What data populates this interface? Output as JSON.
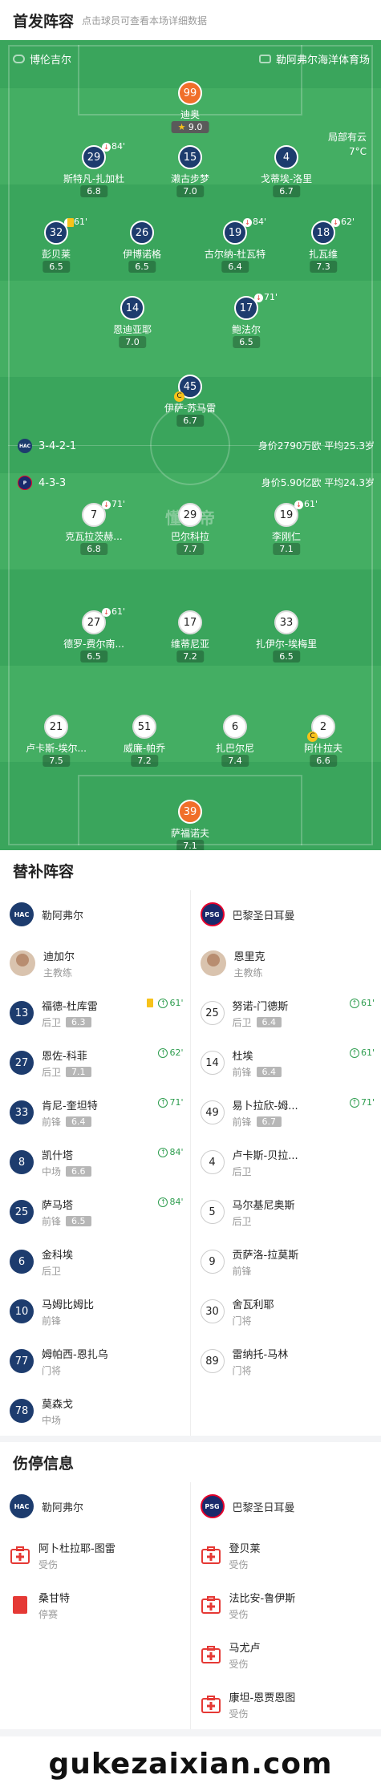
{
  "lineup_header": {
    "title": "首发阵容",
    "subtitle": "点击球员可查看本场详细数据"
  },
  "match": {
    "home_team": "博伦吉尔",
    "venue": "勒阿弗尔海洋体育场",
    "weather": "局部有云",
    "temperature": "7°C",
    "watermark": "懂球帝",
    "home_formation": "3-4-2-1",
    "home_value": "身价2790万欧 平均25.3岁",
    "away_formation": "4-3-3",
    "away_value": "身价5.90亿欧 平均24.3岁"
  },
  "home_players": [
    {
      "num": "99",
      "name": "迪奥",
      "rating": "9.0",
      "best": true
    },
    {
      "num": "29",
      "name": "斯特凡-扎加杜",
      "rating": "6.8",
      "sub": "84'"
    },
    {
      "num": "15",
      "name": "濑古步梦",
      "rating": "7.0"
    },
    {
      "num": "4",
      "name": "戈蒂埃-洛里",
      "rating": "6.7"
    },
    {
      "num": "32",
      "name": "彭贝莱",
      "rating": "6.5",
      "sub": "61'",
      "yellow": true
    },
    {
      "num": "26",
      "name": "伊博诺格",
      "rating": "6.5"
    },
    {
      "num": "19",
      "name": "古尔纳-杜瓦特",
      "rating": "6.4",
      "sub": "84'"
    },
    {
      "num": "18",
      "name": "扎瓦维",
      "rating": "7.3",
      "sub": "62'"
    },
    {
      "num": "14",
      "name": "恩迪亚耶",
      "rating": "7.0"
    },
    {
      "num": "17",
      "name": "鲍法尔",
      "rating": "6.5",
      "sub": "71'"
    },
    {
      "num": "45",
      "name": "伊萨-苏马雷",
      "rating": "6.7",
      "captain": "C"
    }
  ],
  "away_players": [
    {
      "num": "7",
      "name": "克瓦拉茨赫...",
      "rating": "6.8",
      "sub": "71'"
    },
    {
      "num": "29",
      "name": "巴尔科拉",
      "rating": "7.7"
    },
    {
      "num": "19",
      "name": "李刚仁",
      "rating": "7.1",
      "sub": "61'"
    },
    {
      "num": "27",
      "name": "德罗-费尔南...",
      "rating": "6.5",
      "sub": "61'"
    },
    {
      "num": "17",
      "name": "维蒂尼亚",
      "rating": "7.2"
    },
    {
      "num": "33",
      "name": "扎伊尔-埃梅里",
      "rating": "6.5"
    },
    {
      "num": "21",
      "name": "卢卡斯-埃尔...",
      "rating": "7.5"
    },
    {
      "num": "51",
      "name": "威廉-帕乔",
      "rating": "7.2"
    },
    {
      "num": "6",
      "name": "扎巴尔尼",
      "rating": "7.4"
    },
    {
      "num": "2",
      "name": "阿什拉夫",
      "rating": "6.6",
      "captain": "C"
    },
    {
      "num": "39",
      "name": "萨福诺夫",
      "rating": "7.1"
    }
  ],
  "subs": {
    "title": "替补阵容",
    "home_team": "勒阿弗尔",
    "away_team": "巴黎圣日耳曼",
    "home_coach": {
      "name": "迪加尔",
      "role": "主教练"
    },
    "away_coach": {
      "name": "恩里克",
      "role": "主教练"
    },
    "home": [
      {
        "num": "13",
        "name": "福德-杜库雷",
        "pos": "后卫",
        "rating": "6.3",
        "in": "61'",
        "yellow": true
      },
      {
        "num": "27",
        "name": "恩佐-科菲",
        "pos": "后卫",
        "rating": "7.1",
        "in": "62'"
      },
      {
        "num": "33",
        "name": "肯尼-奎坦特",
        "pos": "前锋",
        "rating": "6.4",
        "in": "71'"
      },
      {
        "num": "8",
        "name": "凯什塔",
        "pos": "中场",
        "rating": "6.6",
        "in": "84'"
      },
      {
        "num": "25",
        "name": "萨马塔",
        "pos": "前锋",
        "rating": "6.5",
        "in": "84'"
      },
      {
        "num": "6",
        "name": "金科埃",
        "pos": "后卫"
      },
      {
        "num": "10",
        "name": "马姆比姆比",
        "pos": "前锋"
      },
      {
        "num": "77",
        "name": "姆帕西-恩扎乌",
        "pos": "门将"
      },
      {
        "num": "78",
        "name": "莫森戈",
        "pos": "中场"
      }
    ],
    "away": [
      {
        "num": "25",
        "name": "努诺-门德斯",
        "pos": "后卫",
        "rating": "6.4",
        "in": "61'"
      },
      {
        "num": "14",
        "name": "杜埃",
        "pos": "前锋",
        "rating": "6.4",
        "in": "61'"
      },
      {
        "num": "49",
        "name": "易卜拉欣-姆...",
        "pos": "前锋",
        "rating": "6.7",
        "in": "71'"
      },
      {
        "num": "4",
        "name": "卢卡斯-贝拉...",
        "pos": "后卫"
      },
      {
        "num": "5",
        "name": "马尔基尼奥斯",
        "pos": "后卫"
      },
      {
        "num": "9",
        "name": "贡萨洛-拉莫斯",
        "pos": "前锋"
      },
      {
        "num": "30",
        "name": "舍瓦利耶",
        "pos": "门将"
      },
      {
        "num": "89",
        "name": "雷纳托-马林",
        "pos": "门将"
      }
    ]
  },
  "injuries": {
    "title": "伤停信息",
    "home_team": "勒阿弗尔",
    "away_team": "巴黎圣日耳曼",
    "home": [
      {
        "name": "阿卜杜拉耶-图雷",
        "status": "受伤",
        "icon": "medical-kit-icon"
      },
      {
        "name": "桑甘特",
        "status": "停赛",
        "icon": "red-card-icon"
      }
    ],
    "away": [
      {
        "name": "登贝莱",
        "status": "受伤",
        "icon": "medical-kit-icon"
      },
      {
        "name": "法比安-鲁伊斯",
        "status": "受伤",
        "icon": "medical-kit-icon"
      },
      {
        "name": "马尤卢",
        "status": "受伤",
        "icon": "medical-kit-icon"
      },
      {
        "name": "康坦-恩贾恩图",
        "status": "受伤",
        "icon": "medical-kit-icon"
      }
    ]
  },
  "footer": {
    "site": "gukezaixian.com"
  }
}
